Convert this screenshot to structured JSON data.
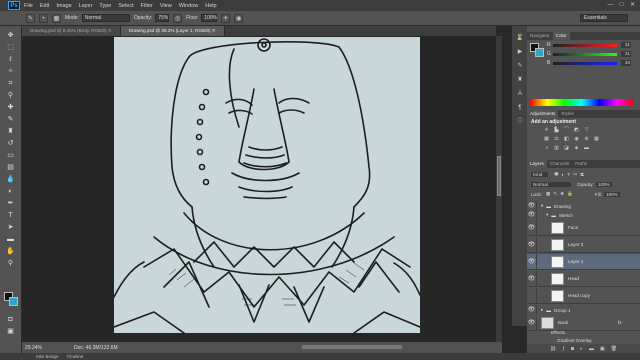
{
  "app": {
    "logo": "Ps"
  },
  "menu": [
    "File",
    "Edit",
    "Image",
    "Layer",
    "Type",
    "Select",
    "Filter",
    "View",
    "Window",
    "Help"
  ],
  "window_controls": {
    "minimize": "—",
    "maximize": "□",
    "close": "✕"
  },
  "options": {
    "mode_label": "Mode:",
    "mode_value": "Normal",
    "opacity_label": "Opacity:",
    "opacity_value": "75%",
    "flow_label": "Flow:",
    "flow_value": "100%",
    "workspace": "Essentials"
  },
  "tabs": [
    {
      "label": "Drawing.psd @ 8.45% (Body, RGB/8) ✕",
      "active": false
    },
    {
      "label": "Drawing.psd @ 29.2% (Layer 1, RGB/8) ✕",
      "active": true
    }
  ],
  "statusbar": {
    "zoom": "29.24%",
    "doc_info": "Doc: 46.3M/132.6M"
  },
  "bottom_tabs": [
    "Mini Bridge",
    "Timeline"
  ],
  "color_panel": {
    "tabs": [
      "Navigator",
      "Color"
    ],
    "r_label": "R",
    "r_value": "31",
    "g_label": "G",
    "g_value": "31",
    "b_label": "B",
    "b_value": "34"
  },
  "adjust_panel": {
    "tabs": [
      "Adjustments",
      "Styles"
    ],
    "title": "Add an adjustment"
  },
  "layers_panel": {
    "tabs": [
      "Layers",
      "Channels",
      "Paths"
    ],
    "kind_label": "Kind",
    "blend_mode": "Normal",
    "opacity_label": "Opacity:",
    "opacity_value": "100%",
    "lock_label": "Lock:",
    "fill_label": "Fill:",
    "fill_value": "100%",
    "groups": {
      "drawing": "Drawing",
      "sketch": "Sketch",
      "group1": "Group 1"
    },
    "layers": [
      {
        "name": "Face",
        "selected": false,
        "visible": true
      },
      {
        "name": "Layer 2",
        "selected": false,
        "visible": true
      },
      {
        "name": "Layer 1",
        "selected": true,
        "visible": true
      },
      {
        "name": "Head",
        "selected": false,
        "visible": true
      },
      {
        "name": "Head copy",
        "selected": false,
        "visible": false
      }
    ],
    "back": {
      "name": "Back",
      "fx": "fx"
    },
    "effects_label": "Effects",
    "effect_item": "Gradient Overlay"
  },
  "colors": {
    "fg": "#111111",
    "bg": "#2ea6c8",
    "selection": "#5d6a7e",
    "panel": "#535353"
  }
}
